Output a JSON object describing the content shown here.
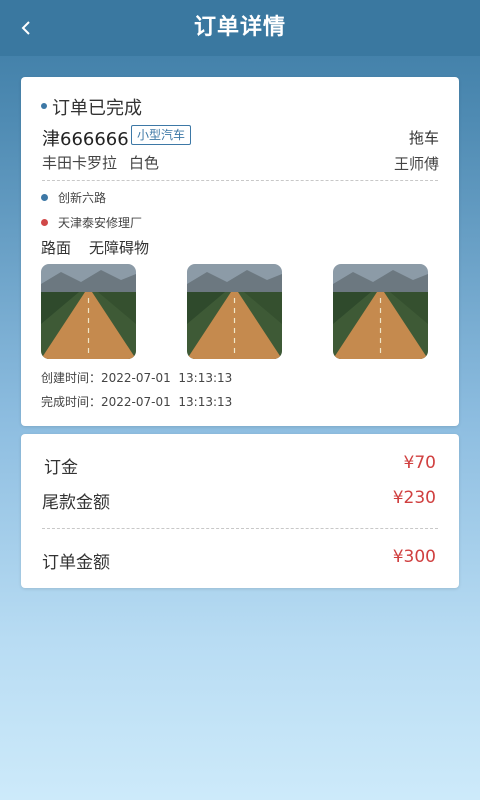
{
  "header": {
    "title": "订单详情",
    "back_icon": "chevron-left-icon"
  },
  "order": {
    "status": "订单已完成",
    "plate": "津666666",
    "car_type": "小型汽车",
    "service": "拖车",
    "car_model": "丰田卡罗拉",
    "car_color": "白色",
    "driver": "王师傅",
    "start_location": "创新六路",
    "end_location": "天津泰安修理厂",
    "road_label": "路面",
    "road_value": "无障碍物",
    "photos": [
      "road-photo-1",
      "road-photo-2",
      "road-photo-3"
    ],
    "created_label": "创建时间：",
    "created_time": "2022-07-01  13:13:13",
    "completed_label": "完成时间：",
    "completed_time": "2022-07-01  13:13:13"
  },
  "fees": {
    "deposit_label": "订金",
    "deposit_value": "¥70",
    "balance_label": "尾款金额",
    "balance_value": "¥230",
    "total_label": "订单金额",
    "total_value": "¥300"
  },
  "colors": {
    "header_bg": "#3a78a0",
    "accent": "#3d78a6",
    "end_dot": "#d04848",
    "price": "#d04040"
  }
}
